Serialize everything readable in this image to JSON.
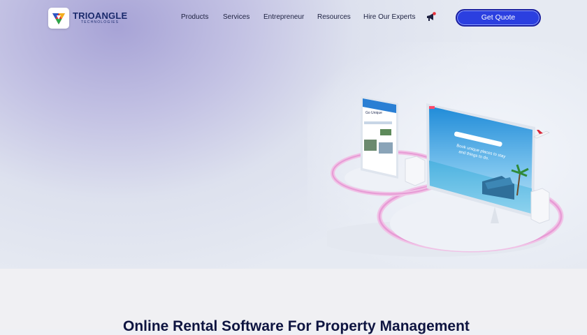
{
  "brand": {
    "name": "TRIOANGLE",
    "tagline": "TECHNOLOGIES"
  },
  "nav": {
    "items": [
      {
        "label": "Products"
      },
      {
        "label": "Services"
      },
      {
        "label": "Entrepreneur"
      },
      {
        "label": "Resources"
      },
      {
        "label": "Hire Our Experts"
      }
    ],
    "cta_label": "Get Quote",
    "notification_icon": "megaphone-icon"
  },
  "hero": {
    "phone_headline": "Go Unique",
    "screen_headline": "Book unique places to stay and things to do."
  },
  "section": {
    "heading": "Online Rental Software For Property Management"
  },
  "colors": {
    "accent": "#2b3fe0",
    "brand_dark": "#1a2a6c",
    "ring": "#e7a6d8"
  }
}
